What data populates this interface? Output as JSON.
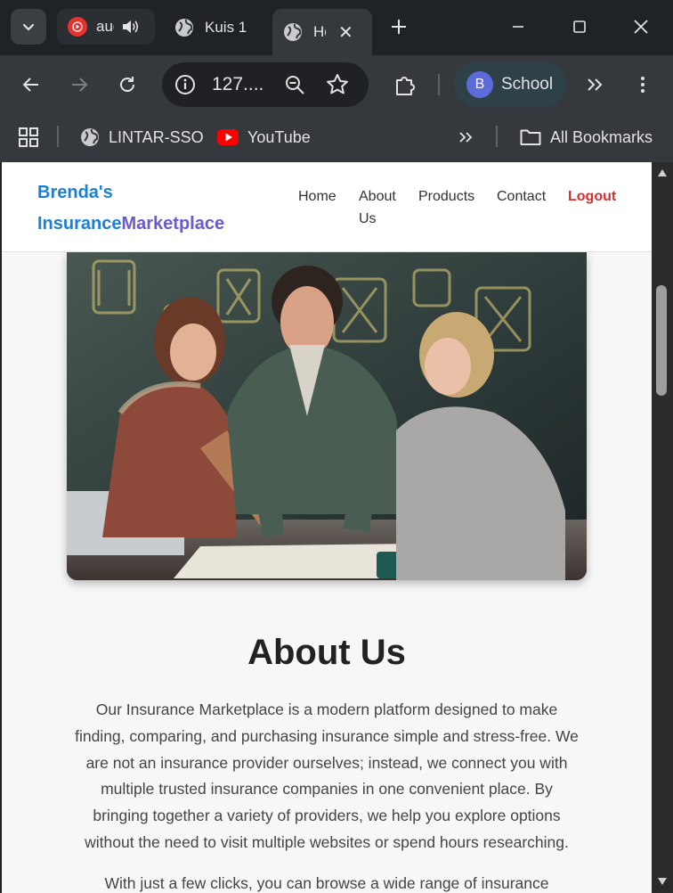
{
  "browser": {
    "tabs": [
      {
        "label": "audio",
        "icon": "youtube-music-icon"
      },
      {
        "label": "Kuis 1",
        "icon": "globe-icon"
      },
      {
        "label": "Home",
        "icon": "globe-icon",
        "active": true
      }
    ],
    "address": "127....",
    "profile": {
      "initial": "B",
      "name": "School"
    },
    "bookmarks": [
      {
        "label": "LINTAR-SSO",
        "icon": "globe-icon"
      },
      {
        "label": "YouTube",
        "icon": "youtube-icon"
      }
    ],
    "all_bookmarks_label": "All Bookmarks"
  },
  "site": {
    "brand_line1": "Brenda's",
    "brand_insurance": "Insurance",
    "brand_marketplace": "Marketplace",
    "nav": {
      "home": "Home",
      "about_1": "About",
      "about_2": "Us",
      "products": "Products",
      "contact": "Contact",
      "logout": "Logout"
    },
    "about": {
      "title": "About Us",
      "paragraph1": "Our Insurance Marketplace is a modern platform designed to make finding, comparing, and purchasing insurance simple and stress-free. We are not an insurance provider ourselves; instead, we connect you with multiple trusted insurance companies in one convenient place. By bringing together a variety of providers, we help you explore options without the need to visit multiple websites or spend hours researching.",
      "paragraph2": "With just a few clicks, you can browse a wide range of insurance"
    }
  },
  "colors": {
    "brand_blue": "#1a7fd6",
    "brand_purple": "#6a5acd",
    "logout_red": "#d32f2f"
  }
}
